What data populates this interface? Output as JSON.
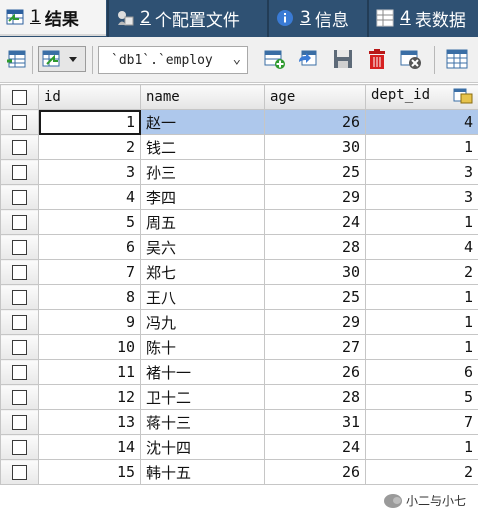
{
  "tabs": [
    {
      "num": "1",
      "label": "结果",
      "active": true,
      "icon": "result-grid-icon"
    },
    {
      "num": "2",
      "label": "个配置文件",
      "active": false,
      "icon": "profile-icon"
    },
    {
      "num": "3",
      "label": "信息",
      "active": false,
      "icon": "info-icon"
    },
    {
      "num": "4",
      "label": "表数据",
      "active": false,
      "icon": "table-data-icon"
    }
  ],
  "toolbar": {
    "table_select_value": "`db1`.`employ",
    "icons": [
      "export-grid-icon",
      "grid-mode-dropdown-icon",
      "add-row-icon",
      "undo-icon",
      "save-icon",
      "delete-row-icon",
      "cancel-icon",
      "form-view-icon"
    ]
  },
  "grid": {
    "columns": [
      "id",
      "name",
      "age",
      "dept_id"
    ],
    "rows": [
      {
        "id": "1",
        "name": "赵一",
        "age": "26",
        "dept_id": "4"
      },
      {
        "id": "2",
        "name": "钱二",
        "age": "30",
        "dept_id": "1"
      },
      {
        "id": "3",
        "name": "孙三",
        "age": "25",
        "dept_id": "3"
      },
      {
        "id": "4",
        "name": "李四",
        "age": "29",
        "dept_id": "3"
      },
      {
        "id": "5",
        "name": "周五",
        "age": "24",
        "dept_id": "1"
      },
      {
        "id": "6",
        "name": "吴六",
        "age": "28",
        "dept_id": "4"
      },
      {
        "id": "7",
        "name": "郑七",
        "age": "30",
        "dept_id": "2"
      },
      {
        "id": "8",
        "name": "王八",
        "age": "25",
        "dept_id": "1"
      },
      {
        "id": "9",
        "name": "冯九",
        "age": "29",
        "dept_id": "1"
      },
      {
        "id": "10",
        "name": "陈十",
        "age": "27",
        "dept_id": "1"
      },
      {
        "id": "11",
        "name": "褚十一",
        "age": "26",
        "dept_id": "6"
      },
      {
        "id": "12",
        "name": "卫十二",
        "age": "28",
        "dept_id": "5"
      },
      {
        "id": "13",
        "name": "蒋十三",
        "age": "31",
        "dept_id": "7"
      },
      {
        "id": "14",
        "name": "沈十四",
        "age": "24",
        "dept_id": "1"
      },
      {
        "id": "15",
        "name": "韩十五",
        "age": "26",
        "dept_id": "2"
      }
    ],
    "selected_row": 0
  },
  "watermark": {
    "text": "小二与小七"
  },
  "colors": {
    "tabbar": "#2f5173",
    "selection": "#aec8ec",
    "toolbar": "#f0f0f0"
  }
}
